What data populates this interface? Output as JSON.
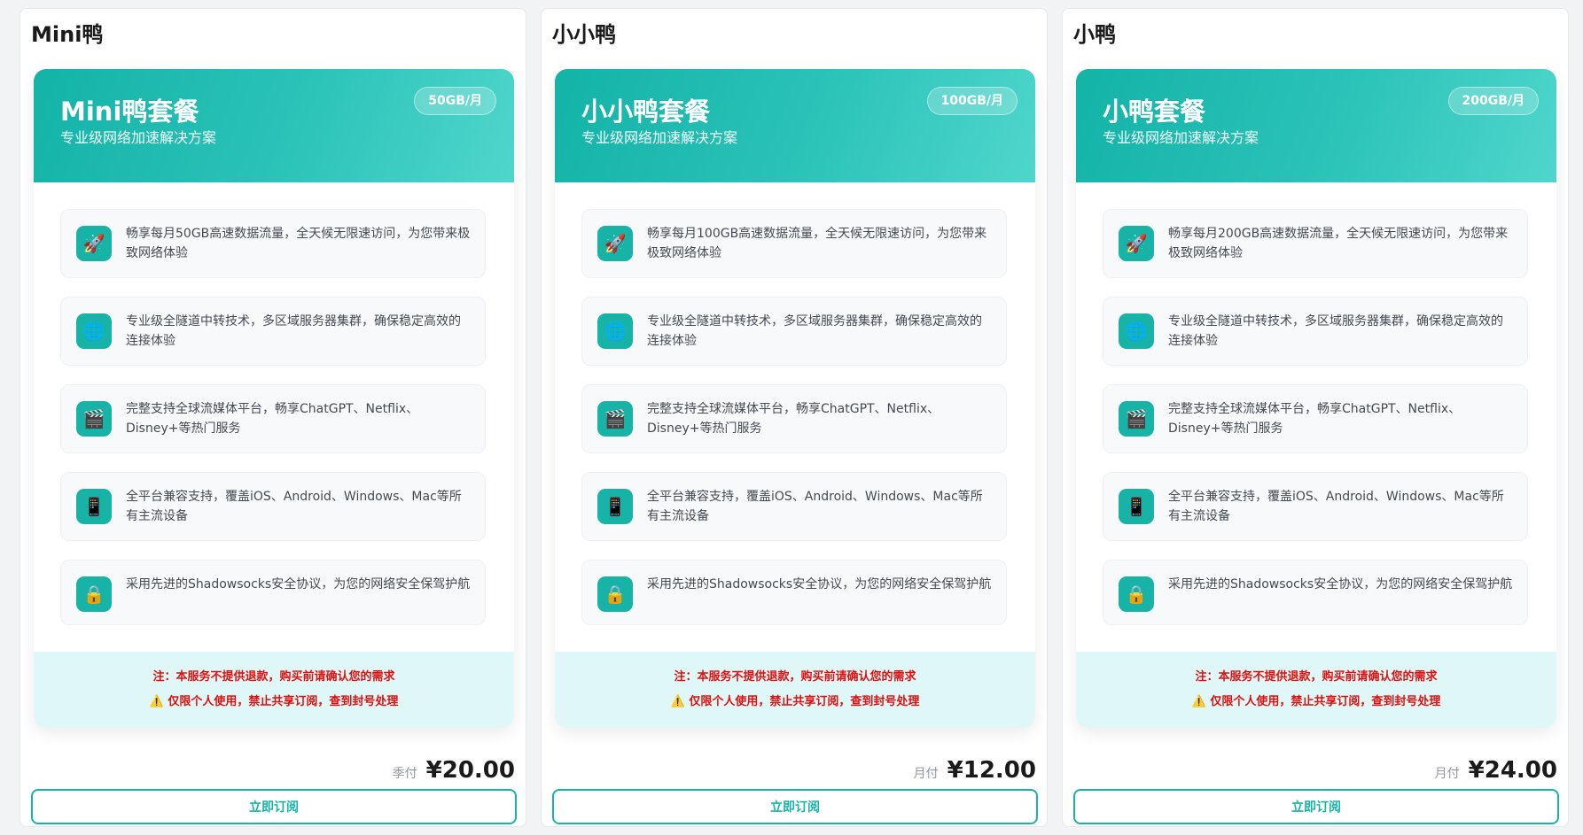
{
  "plans": [
    {
      "card_title": "Mini鸭",
      "name": "Mini鸭套餐",
      "subtitle": "专业级网络加速解决方案",
      "badge": "50GB/月",
      "features": [
        {
          "icon": "rocket-icon",
          "glyph": "🚀",
          "text": "畅享每月50GB高速数据流量，全天候无限速访问，为您带来极致网络体验"
        },
        {
          "icon": "globe-icon",
          "glyph": "🌐",
          "text": "专业级全隧道中转技术，多区域服务器集群，确保稳定高效的连接体验"
        },
        {
          "icon": "clapper-icon",
          "glyph": "🎬",
          "text": "完整支持全球流媒体平台，畅享ChatGPT、Netflix、Disney+等热门服务"
        },
        {
          "icon": "phone-icon",
          "glyph": "📱",
          "text": "全平台兼容支持，覆盖iOS、Android、Windows、Mac等所有主流设备"
        },
        {
          "icon": "lock-icon",
          "glyph": "🔒",
          "text": "采用先进的Shadowsocks安全协议，为您的网络安全保驾护航"
        }
      ],
      "notice_1": "注：本服务不提供退款，购买前请确认您的需求",
      "notice_2": "仅限个人使用，禁止共享订阅，查到封号处理",
      "period": "季付",
      "price": "¥20.00",
      "button": "立即订阅"
    },
    {
      "card_title": "小小鸭",
      "name": "小小鸭套餐",
      "subtitle": "专业级网络加速解决方案",
      "badge": "100GB/月",
      "features": [
        {
          "icon": "rocket-icon",
          "glyph": "🚀",
          "text": "畅享每月100GB高速数据流量，全天候无限速访问，为您带来极致网络体验"
        },
        {
          "icon": "globe-icon",
          "glyph": "🌐",
          "text": "专业级全隧道中转技术，多区域服务器集群，确保稳定高效的连接体验"
        },
        {
          "icon": "clapper-icon",
          "glyph": "🎬",
          "text": "完整支持全球流媒体平台，畅享ChatGPT、Netflix、Disney+等热门服务"
        },
        {
          "icon": "phone-icon",
          "glyph": "📱",
          "text": "全平台兼容支持，覆盖iOS、Android、Windows、Mac等所有主流设备"
        },
        {
          "icon": "lock-icon",
          "glyph": "🔒",
          "text": "采用先进的Shadowsocks安全协议，为您的网络安全保驾护航"
        }
      ],
      "notice_1": "注：本服务不提供退款，购买前请确认您的需求",
      "notice_2": "仅限个人使用，禁止共享订阅，查到封号处理",
      "period": "月付",
      "price": "¥12.00",
      "button": "立即订阅"
    },
    {
      "card_title": "小鸭",
      "name": "小鸭套餐",
      "subtitle": "专业级网络加速解决方案",
      "badge": "200GB/月",
      "features": [
        {
          "icon": "rocket-icon",
          "glyph": "🚀",
          "text": "畅享每月200GB高速数据流量，全天候无限速访问，为您带来极致网络体验"
        },
        {
          "icon": "globe-icon",
          "glyph": "🌐",
          "text": "专业级全隧道中转技术，多区域服务器集群，确保稳定高效的连接体验"
        },
        {
          "icon": "clapper-icon",
          "glyph": "🎬",
          "text": "完整支持全球流媒体平台，畅享ChatGPT、Netflix、Disney+等热门服务"
        },
        {
          "icon": "phone-icon",
          "glyph": "📱",
          "text": "全平台兼容支持，覆盖iOS、Android、Windows、Mac等所有主流设备"
        },
        {
          "icon": "lock-icon",
          "glyph": "🔒",
          "text": "采用先进的Shadowsocks安全协议，为您的网络安全保驾护航"
        }
      ],
      "notice_1": "注：本服务不提供退款，购买前请确认您的需求",
      "notice_2": "仅限个人使用，禁止共享订阅，查到封号处理",
      "period": "月付",
      "price": "¥24.00",
      "button": "立即订阅"
    }
  ],
  "warning_glyph": "⚠️",
  "colors": {
    "accent": "#17b3a7",
    "notice_bg": "#e0f7f7",
    "notice_text": "#e01010"
  }
}
